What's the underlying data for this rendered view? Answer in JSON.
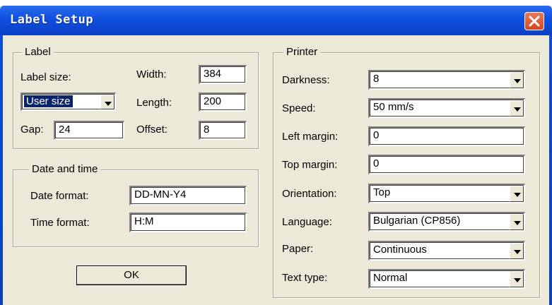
{
  "window": {
    "title": "Label Setup"
  },
  "label_group": {
    "legend": "Label",
    "label_size_label": "Label size:",
    "label_size_value": "User size",
    "gap_label": "Gap:",
    "gap_value": "24",
    "width_label": "Width:",
    "width_value": "384",
    "length_label": "Length:",
    "length_value": "200",
    "offset_label": "Offset:",
    "offset_value": "8"
  },
  "datetime_group": {
    "legend": "Date and time",
    "date_format_label": "Date format:",
    "date_format_value": "DD-MN-Y4",
    "time_format_label": "Time format:",
    "time_format_value": "H:M"
  },
  "ok_button": "OK",
  "printer_group": {
    "legend": "Printer",
    "darkness_label": "Darkness:",
    "darkness_value": "8",
    "speed_label": "Speed:",
    "speed_value": "50 mm/s",
    "left_margin_label": "Left margin:",
    "left_margin_value": "0",
    "top_margin_label": "Top margin:",
    "top_margin_value": "0",
    "orientation_label": "Orientation:",
    "orientation_value": "Top",
    "language_label": "Language:",
    "language_value": "Bulgarian (CP856)",
    "paper_label": "Paper:",
    "paper_value": "Continuous",
    "text_type_label": "Text type:",
    "text_type_value": "Normal"
  },
  "colors": {
    "titlebar": "#0a3fc4",
    "dialog_bg": "#ece9d8",
    "close_button": "#d2451f",
    "selection": "#0a246a"
  },
  "icons": {
    "close": "close-icon",
    "dropdown": "chevron-down-icon"
  }
}
